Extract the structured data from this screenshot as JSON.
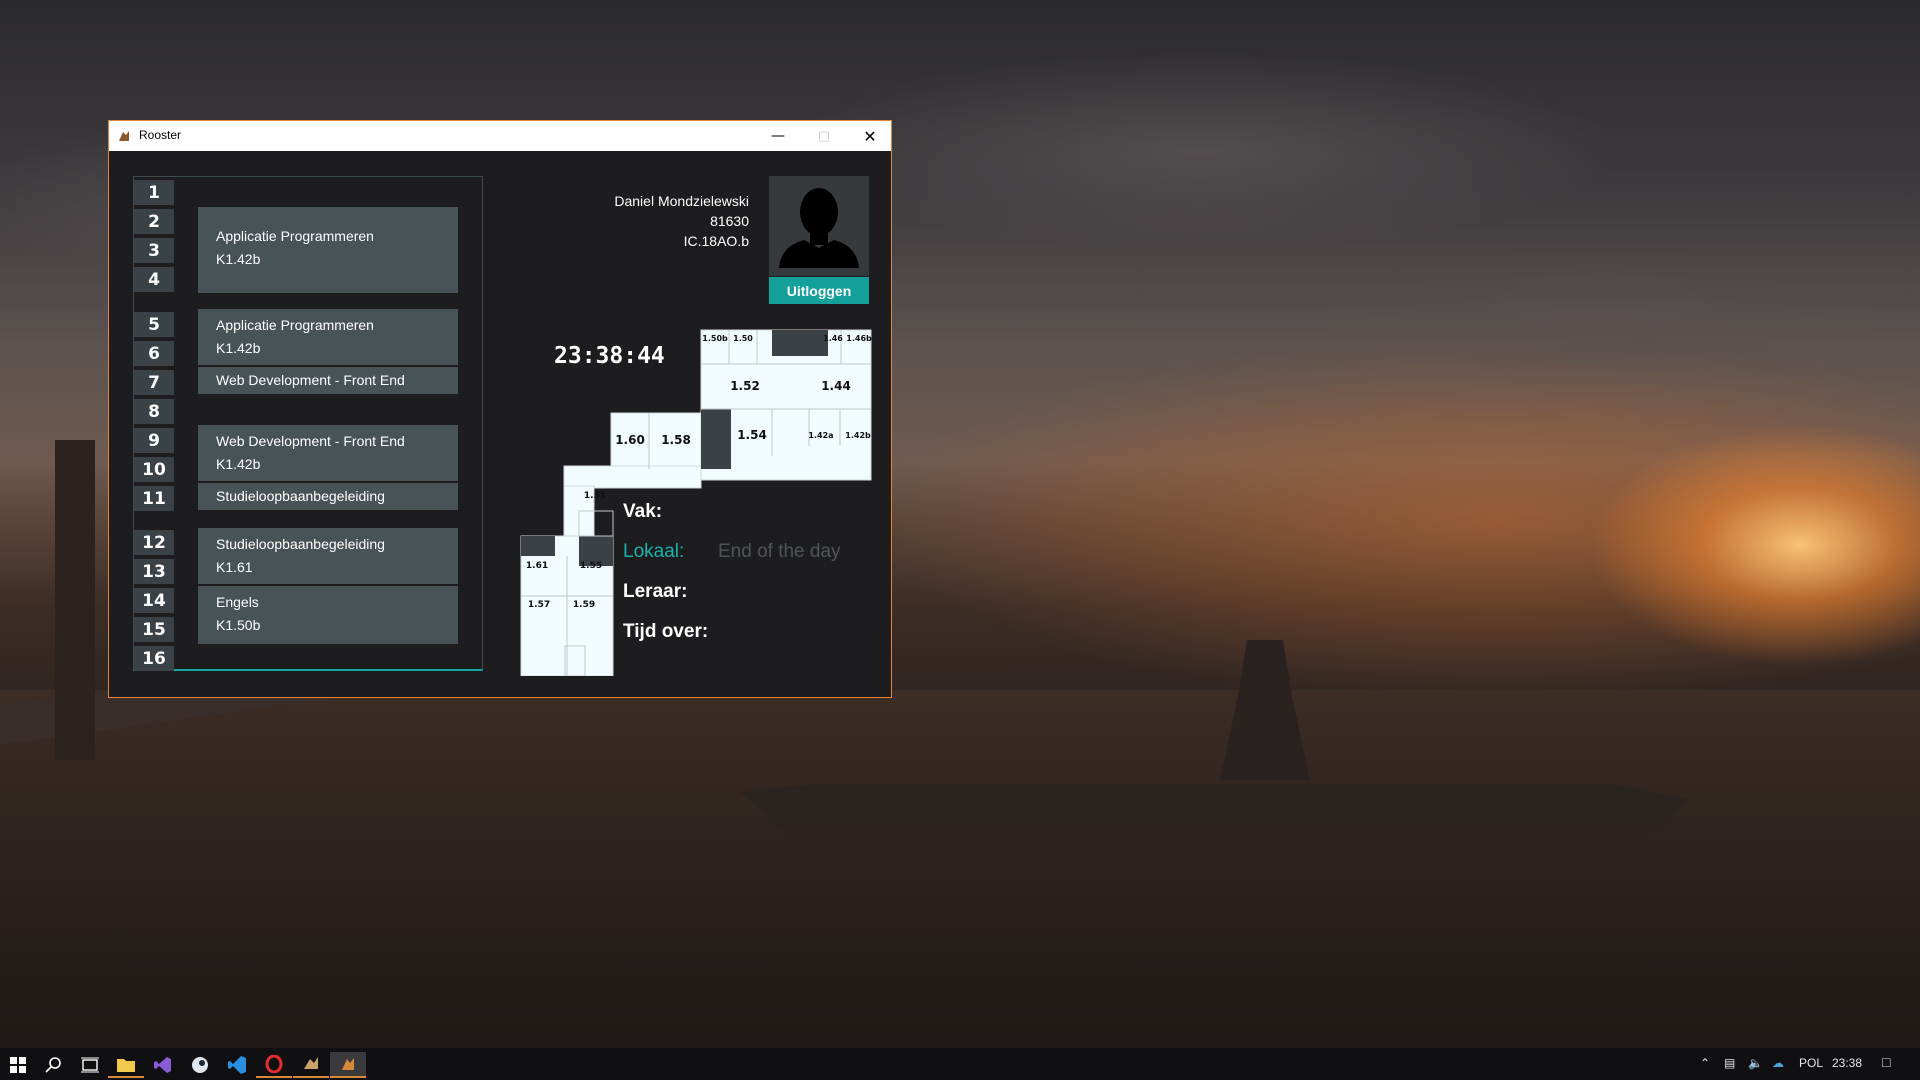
{
  "window": {
    "title": "Rooster"
  },
  "schedule": {
    "hours": [
      "1",
      "2",
      "3",
      "4",
      "5",
      "6",
      "7",
      "8",
      "9",
      "10",
      "11",
      "12",
      "13",
      "14",
      "15",
      "16"
    ],
    "slots": [
      {
        "line1": "Applicatie Programmeren",
        "line2": "K1.42b"
      },
      {
        "line1": "Applicatie Programmeren",
        "line2": "K1.42b"
      },
      {
        "line1": "Web Development - Front End",
        "line2": ""
      },
      {
        "line1": "Web Development - Front End",
        "line2": "K1.42b"
      },
      {
        "line1": "Studieloopbaanbegeleiding",
        "line2": ""
      },
      {
        "line1": "Studieloopbaanbegeleiding",
        "line2": "K1.61"
      },
      {
        "line1": "Engels",
        "line2": "K1.50b"
      }
    ]
  },
  "user": {
    "name": "Daniel Mondzielewski",
    "number": "81630",
    "class": "IC.18AO.b"
  },
  "logout_label": "Uitloggen",
  "clock": "23:38:44",
  "map": {
    "rooms": [
      "1.50b",
      "1.50",
      "1.46",
      "1.46b",
      "1.52",
      "1.44",
      "1.60",
      "1.58",
      "1.54",
      "1.42a",
      "1.42b",
      "1.51",
      "1.61",
      "1.55",
      "1.57",
      "1.59"
    ]
  },
  "info": {
    "vak_label": "Vak:",
    "lokaal_label": "Lokaal:",
    "lokaal_value": "End of the day",
    "leraar_label": "Leraar:",
    "tijd_label": "Tijd over:"
  },
  "taskbar": {
    "language": "POL",
    "time": "23:38"
  },
  "colors": {
    "accent": "#13a09b",
    "window_border": "#e8843a",
    "window_bg": "#1d1d1f",
    "slot_bg": "#475357",
    "hour_bg": "#3a4247"
  }
}
